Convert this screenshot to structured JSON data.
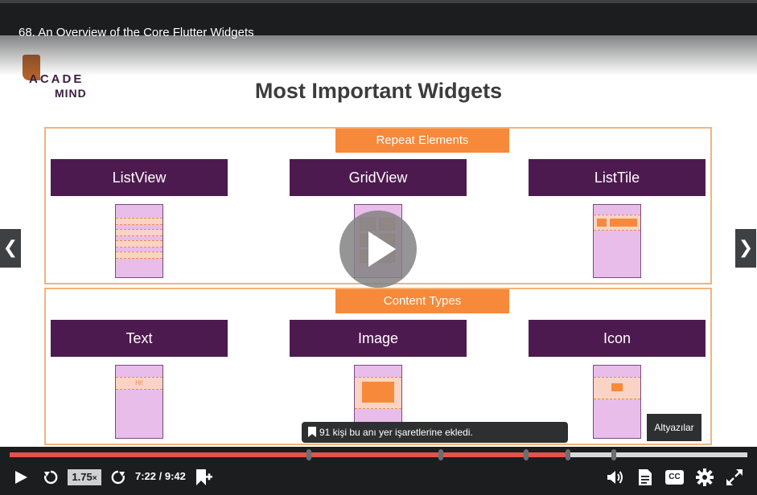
{
  "video_title": "68. An Overview of the Core Flutter Widgets",
  "slide": {
    "logo_line1": "ACADE",
    "logo_line2": "MIND",
    "title": "Most Important Widgets",
    "sections": [
      {
        "label": "Repeat Elements",
        "widgets": [
          "ListView",
          "GridView",
          "ListTile"
        ]
      },
      {
        "label": "Content Types",
        "widgets": [
          "Text",
          "Image",
          "Icon"
        ],
        "text_sample": "Hi!"
      }
    ]
  },
  "tooltips": {
    "bookmark": "91 kişi bu anı yer işaretlerine ekledi.",
    "subtitles": "Altyazılar"
  },
  "player": {
    "speed": "1.75",
    "speed_suffix": "×",
    "time": "7:22 / 9:42",
    "cc_label": "CC",
    "progress_fraction": 0.758,
    "bookmarks_fraction": [
      0.406,
      0.584,
      0.7,
      0.757,
      0.819
    ],
    "colors": {
      "progress": "#e8514a",
      "background": "#1c1d1f",
      "accent_orange": "#f7893a",
      "widget_purple": "#4d1a4f"
    },
    "icons": [
      "play-icon",
      "rewind-icon",
      "forward-icon",
      "add-bookmark-icon",
      "volume-icon",
      "transcript-icon",
      "cc-icon",
      "settings-icon",
      "fullscreen-icon",
      "chevron-left-icon",
      "chevron-right-icon"
    ]
  }
}
